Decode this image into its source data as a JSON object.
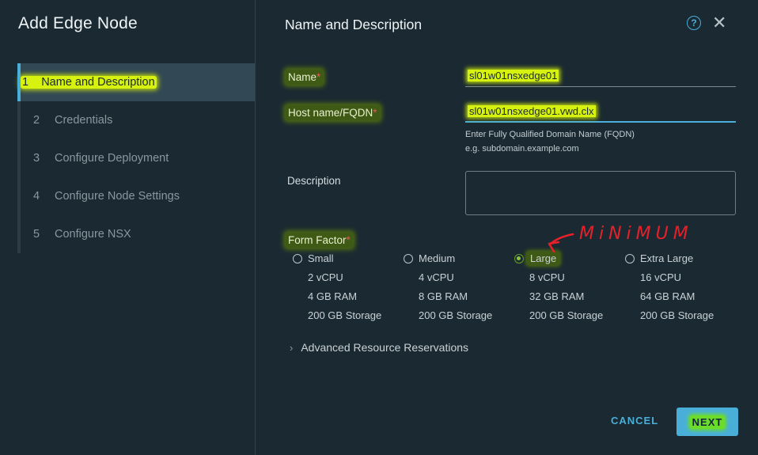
{
  "wizard": {
    "title": "Add Edge Node",
    "steps": [
      {
        "num": "1",
        "label": "Name and Description"
      },
      {
        "num": "2",
        "label": "Credentials"
      },
      {
        "num": "3",
        "label": "Configure Deployment"
      },
      {
        "num": "4",
        "label": "Configure Node Settings"
      },
      {
        "num": "5",
        "label": "Configure NSX"
      }
    ]
  },
  "page": {
    "title": "Name and Description",
    "help_icon": "?",
    "close_icon": "✕"
  },
  "form": {
    "name_label": "Name",
    "name_value": "sl01w01nsxedge01",
    "host_label": "Host name/FQDN",
    "host_value": "sl01w01nsxedge01.vwd.clx",
    "host_hint1": "Enter Fully Qualified Domain Name (FQDN)",
    "host_hint2": "e.g. subdomain.example.com",
    "desc_label": "Description",
    "desc_value": "",
    "required_mark": "*",
    "ff_label": "Form Factor",
    "form_factors": [
      {
        "name": "Small",
        "cpu": "2 vCPU",
        "ram": "4 GB RAM",
        "storage": "200 GB Storage",
        "selected": false
      },
      {
        "name": "Medium",
        "cpu": "4 vCPU",
        "ram": "8 GB RAM",
        "storage": "200 GB Storage",
        "selected": false
      },
      {
        "name": "Large",
        "cpu": "8 vCPU",
        "ram": "32 GB RAM",
        "storage": "200 GB Storage",
        "selected": true
      },
      {
        "name": "Extra Large",
        "cpu": "16 vCPU",
        "ram": "64 GB RAM",
        "storage": "200 GB Storage",
        "selected": false
      }
    ],
    "advanced_label": "Advanced Resource Reservations",
    "advanced_chevron": "›"
  },
  "annotation": {
    "text": "MiNiMUM",
    "color": "#e8202a"
  },
  "footer": {
    "cancel_label": "CANCEL",
    "next_label": "NEXT"
  },
  "colors": {
    "accent": "#49afd9",
    "highlight": "#d7f20f",
    "required": "#e05a5a"
  }
}
